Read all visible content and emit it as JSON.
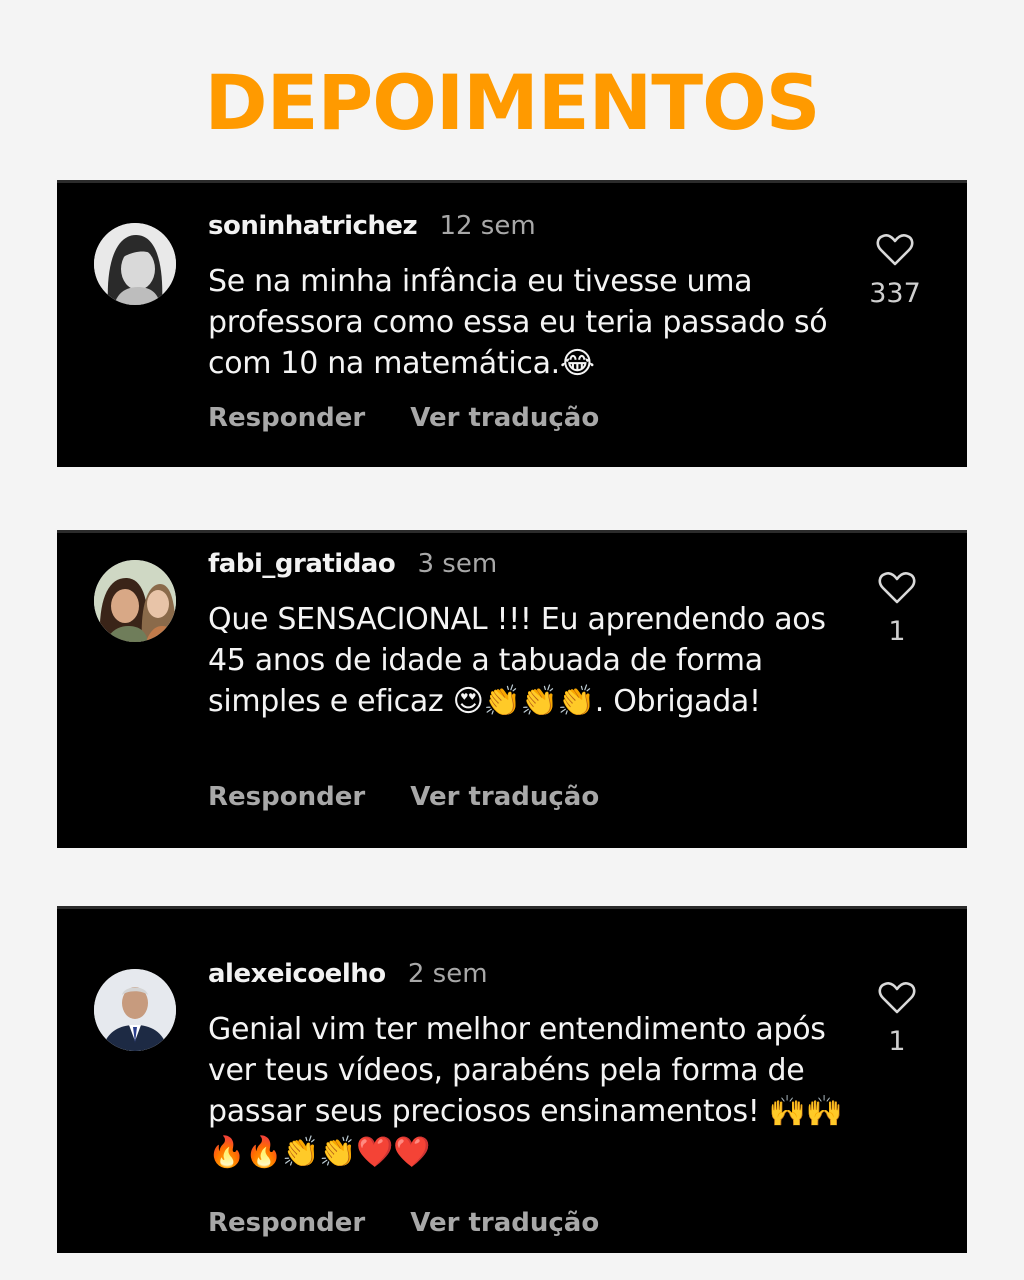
{
  "page": {
    "title": "DEPOIMENTOS"
  },
  "colors": {
    "accent": "#ff9a00",
    "card_bg": "#000000",
    "page_bg": "#f4f4f4",
    "muted_text": "#a8a8a8"
  },
  "comments": [
    {
      "username": "soninhatrichez",
      "time": "12 sem",
      "text": "Se na minha infância eu tivesse uma professora como essa eu teria passado só com 10 na matemática.",
      "emojis": "😂",
      "reply_label": "Responder",
      "translate_label": "Ver tradução",
      "likes": "337",
      "avatar_icon": "user-avatar-woman"
    },
    {
      "username": "fabi_gratidao",
      "time": "3 sem",
      "text": "Que  SENSACIONAL !!! Eu aprendendo aos 45 anos de idade a tabuada de forma simples e eficaz",
      "emojis": "😍👏👏👏",
      "text_end": ". Obrigada!",
      "reply_label": "Responder",
      "translate_label": "Ver tradução",
      "likes": "1",
      "avatar_icon": "user-avatar-woman-child"
    },
    {
      "username": "alexeicoelho",
      "time": "2 sem",
      "text": "Genial vim ter melhor entendimento após ver teus vídeos, parabéns pela forma de passar seus preciosos ensinamentos!",
      "emojis": "🙌🙌🔥🔥👏👏❤️❤️",
      "reply_label": "Responder",
      "translate_label": "Ver tradução",
      "likes": "1",
      "avatar_icon": "user-avatar-man-suit"
    }
  ],
  "icons": {
    "like": "heart-outline-icon"
  }
}
